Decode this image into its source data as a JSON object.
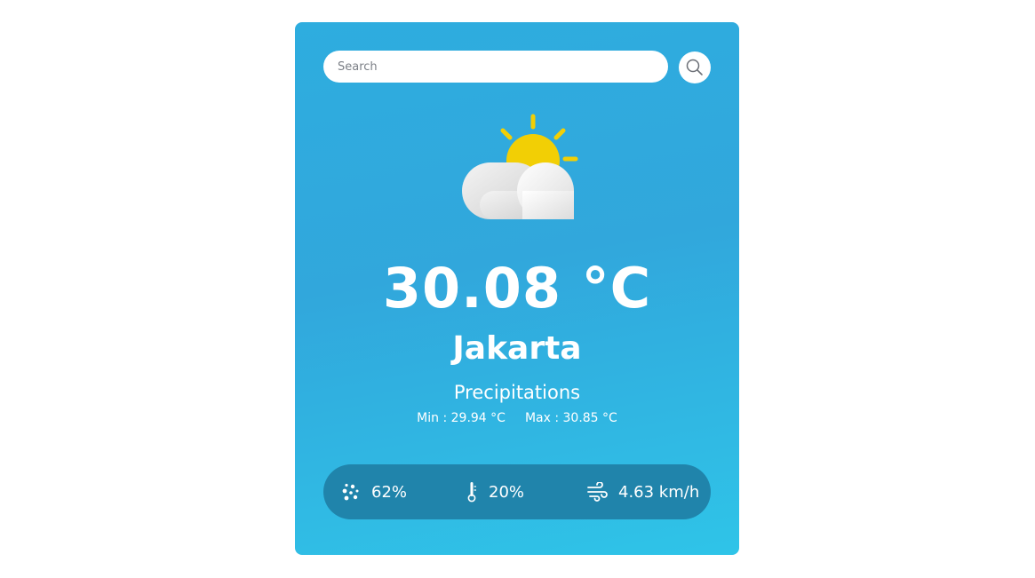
{
  "search": {
    "placeholder": "Search",
    "value": ""
  },
  "weather": {
    "icon": "partly-cloudy-icon",
    "temperature": "30.08 °C",
    "city": "Jakarta",
    "condition": "Precipitations",
    "min": "Min : 29.94 °C",
    "max": "Max : 30.85 °C"
  },
  "stats": {
    "humidity": "62%",
    "precipitation": "20%",
    "wind": "4.63 km/h"
  },
  "colors": {
    "card_gradient_top": "#2eaddf",
    "card_gradient_bottom": "#2fc4e8",
    "stats_bar": "#2084ab",
    "sun": "#f2cf05",
    "text": "#ffffff"
  }
}
